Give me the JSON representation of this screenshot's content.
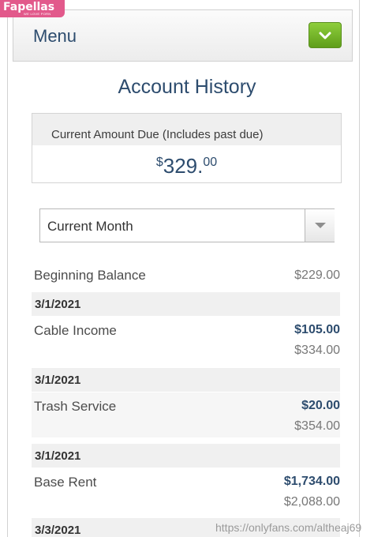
{
  "watermark": {
    "logo": "Fapellas",
    "tagline": "WE LOVE PORN",
    "url": "https://onlyfans.com/altheaj69"
  },
  "menu": {
    "label": "Menu",
    "toggle_icon": "chevron-down-icon"
  },
  "page": {
    "title": "Account History"
  },
  "amount_due": {
    "label": "Current Amount Due (Includes past due)",
    "currency_symbol": "$",
    "dollars": "329.",
    "cents": "00"
  },
  "filter": {
    "selected": "Current Month"
  },
  "beginning_balance": {
    "label": "Beginning Balance",
    "amount": "$229.00"
  },
  "transactions": [
    {
      "date": "3/1/2021",
      "description": "Cable Income",
      "amount": "$105.00",
      "balance": "$334.00"
    },
    {
      "date": "3/1/2021",
      "description": "Trash Service",
      "amount": "$20.00",
      "balance": "$354.00"
    },
    {
      "date": "3/1/2021",
      "description": "Base Rent",
      "amount": "$1,734.00",
      "balance": "$2,088.00"
    },
    {
      "date": "3/3/2021"
    }
  ],
  "colors": {
    "heading": "#2d4c6e",
    "toggle_green": "#6fb12a",
    "band_gray": "#f0f0f0",
    "logo_pink": "#e2598b"
  }
}
